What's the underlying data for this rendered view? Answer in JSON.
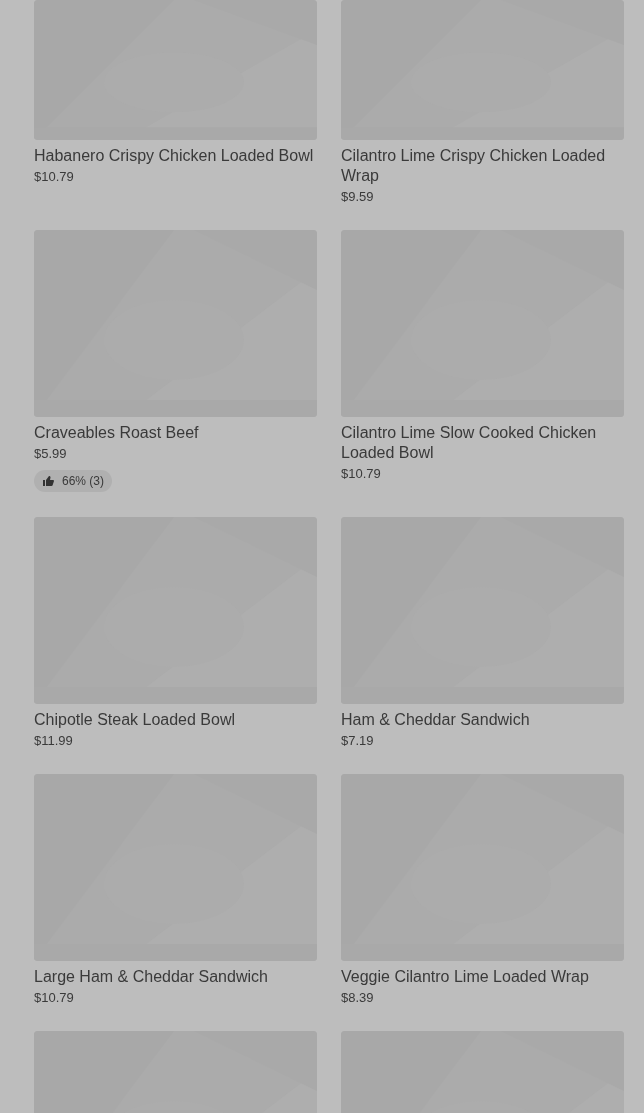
{
  "items": [
    {
      "kind": "product",
      "name": "Habanero Crispy Chicken Loaded Bowl",
      "price": "$10.79"
    },
    {
      "kind": "product",
      "name": "Cilantro Lime Crispy Chicken Loaded Wrap",
      "price": "$9.59"
    },
    {
      "kind": "product",
      "name": "Craveables Roast Beef",
      "price": "$5.99",
      "rating": "66% (3)"
    },
    {
      "kind": "product",
      "name": "Cilantro Lime Slow Cooked Chicken Loaded Bowl",
      "price": "$10.79"
    },
    {
      "kind": "product",
      "name": "Chipotle Steak Loaded Bowl",
      "price": "$11.99"
    },
    {
      "kind": "product",
      "name": "Ham & Cheddar Sandwich",
      "price": "$7.19"
    },
    {
      "kind": "product",
      "name": "Large Ham & Cheddar Sandwich",
      "price": "$10.79"
    },
    {
      "kind": "product",
      "name": "Veggie Cilantro Lime Loaded Wrap",
      "price": "$8.39"
    },
    {
      "kind": "picture"
    },
    {
      "kind": "picture"
    }
  ]
}
